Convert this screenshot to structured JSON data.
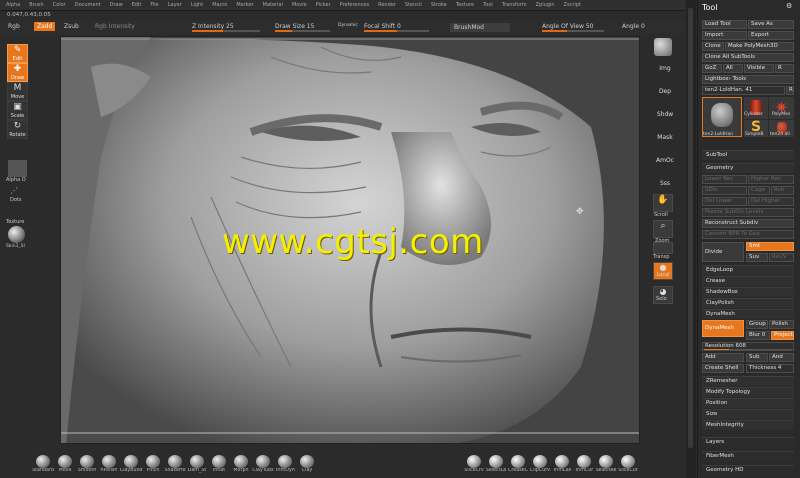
{
  "menu": [
    "Alpha",
    "Brush",
    "Color",
    "Document",
    "Draw",
    "Edit",
    "File",
    "Layer",
    "Light",
    "Macro",
    "Marker",
    "Material",
    "Movie",
    "Picker",
    "Preferences",
    "Render",
    "Stencil",
    "Stroke",
    "Texture",
    "Tool",
    "Transform",
    "Zplugin",
    "Zscript"
  ],
  "coords": "0.047,0.43,0.05",
  "toolbar": {
    "rgb": "Rgb",
    "zadd": "Zadd",
    "zsub": "Zsub",
    "rgb_intensity": "Rgb Intensity",
    "z_intensity": "Z Intensity 25",
    "draw_size": "Draw Size 15",
    "dynamic": "Dynamic",
    "focal_shift": "Focal Shift 0",
    "brushmod": "BrushMod",
    "angle_of_view": "Angle Of View 50",
    "angle": "Angle 0"
  },
  "left_shelf": {
    "edit": "Edit",
    "draw": "Draw",
    "move": "Move",
    "scale": "Scale",
    "rotate": "Rotate",
    "alpha": "Alpha O",
    "dots": "Dots",
    "texture": "Texture",
    "material": "Skin1_SI"
  },
  "right_shelf": {
    "img": "Img",
    "dep": "Dep",
    "shdw": "Shdw",
    "mask": "Mask",
    "amoc": "AmOc",
    "sss": "Sss",
    "scroll": "Scroll",
    "zoom": "Zoom",
    "transp": "Transp",
    "local": "Local",
    "solo": "Solo"
  },
  "palette": {
    "title": "Tool",
    "load_tool": "Load Tool",
    "save_as": "Save As",
    "import": "Import",
    "export": "Export",
    "clone": "Clone",
    "make_polymesh": "Make PolyMesh3D",
    "clone_all": "Clone All SubTools",
    "goz": "GoZ",
    "all": "All",
    "visible": "Visible",
    "r": "R",
    "lightbox_tools": "Lightbox› Tools",
    "current_tool": "ten2-LoldHan. 41",
    "r2": "R",
    "thumb_labels": [
      "ten2-LoldHan",
      "Cylinder",
      "PolyMes",
      "SimpleB",
      "ten24 all"
    ],
    "subtool": "SubTool",
    "geometry": "Geometry",
    "lower_res": "Lower Res",
    "higher_res": "Higher Res",
    "sdiv": "SDiv",
    "cage": "Cage",
    "rstr": "Rstr",
    "del_lower": "Del Lower",
    "del_higher": "Del Higher",
    "freeze_subdiv": "Freeze SubDiv Levels",
    "reconstruct": "Reconstruct Subdiv",
    "convert_bpr": "Convert BPR To Geo",
    "divide": "Divide",
    "smt": "Smt",
    "suv": "Suv",
    "reuv": "ReUV",
    "edgeloop": "EdgeLoop",
    "crease": "Crease",
    "shadowbox": "ShadowBox",
    "claypolish": "ClayPolish",
    "dynamesh_head": "DynaMesh",
    "dynamesh_btn": "DynaMesh",
    "group": "Group",
    "polish": "Polish",
    "blur": "Blur 0",
    "project": "Project",
    "resolution": "Resolution 608",
    "add": "Add",
    "sub": "Sub",
    "and": "And",
    "create_shell": "Create Shell",
    "thickness": "Thickness 4",
    "zremesher": "ZRemesher",
    "modify_topology": "Modify Topology",
    "position": "Position",
    "size": "Size",
    "meshintegrity": "MeshIntegrity",
    "layers": "Layers",
    "fibermesh": "FiberMesh",
    "geometry_hd": "Geometry HD"
  },
  "brushes": [
    "Standard",
    "Move",
    "Smooth",
    "hPolish",
    "ClayBuild",
    "Pinch",
    "SnakeHo",
    "Dam_St",
    "Inflat",
    "Morph",
    "ClayTubs",
    "TrimDyn",
    "Clay"
  ],
  "right_tools": [
    "SliceCrv",
    "SelectLa",
    "CreaseC",
    "ClipCurv",
    "TrimLas",
    "TrimCur",
    "SelectRe",
    "SliceCur"
  ],
  "watermark": "www.cgtsj.com",
  "colors": {
    "accent": "#e8761c",
    "watermark": "#f4f000"
  }
}
